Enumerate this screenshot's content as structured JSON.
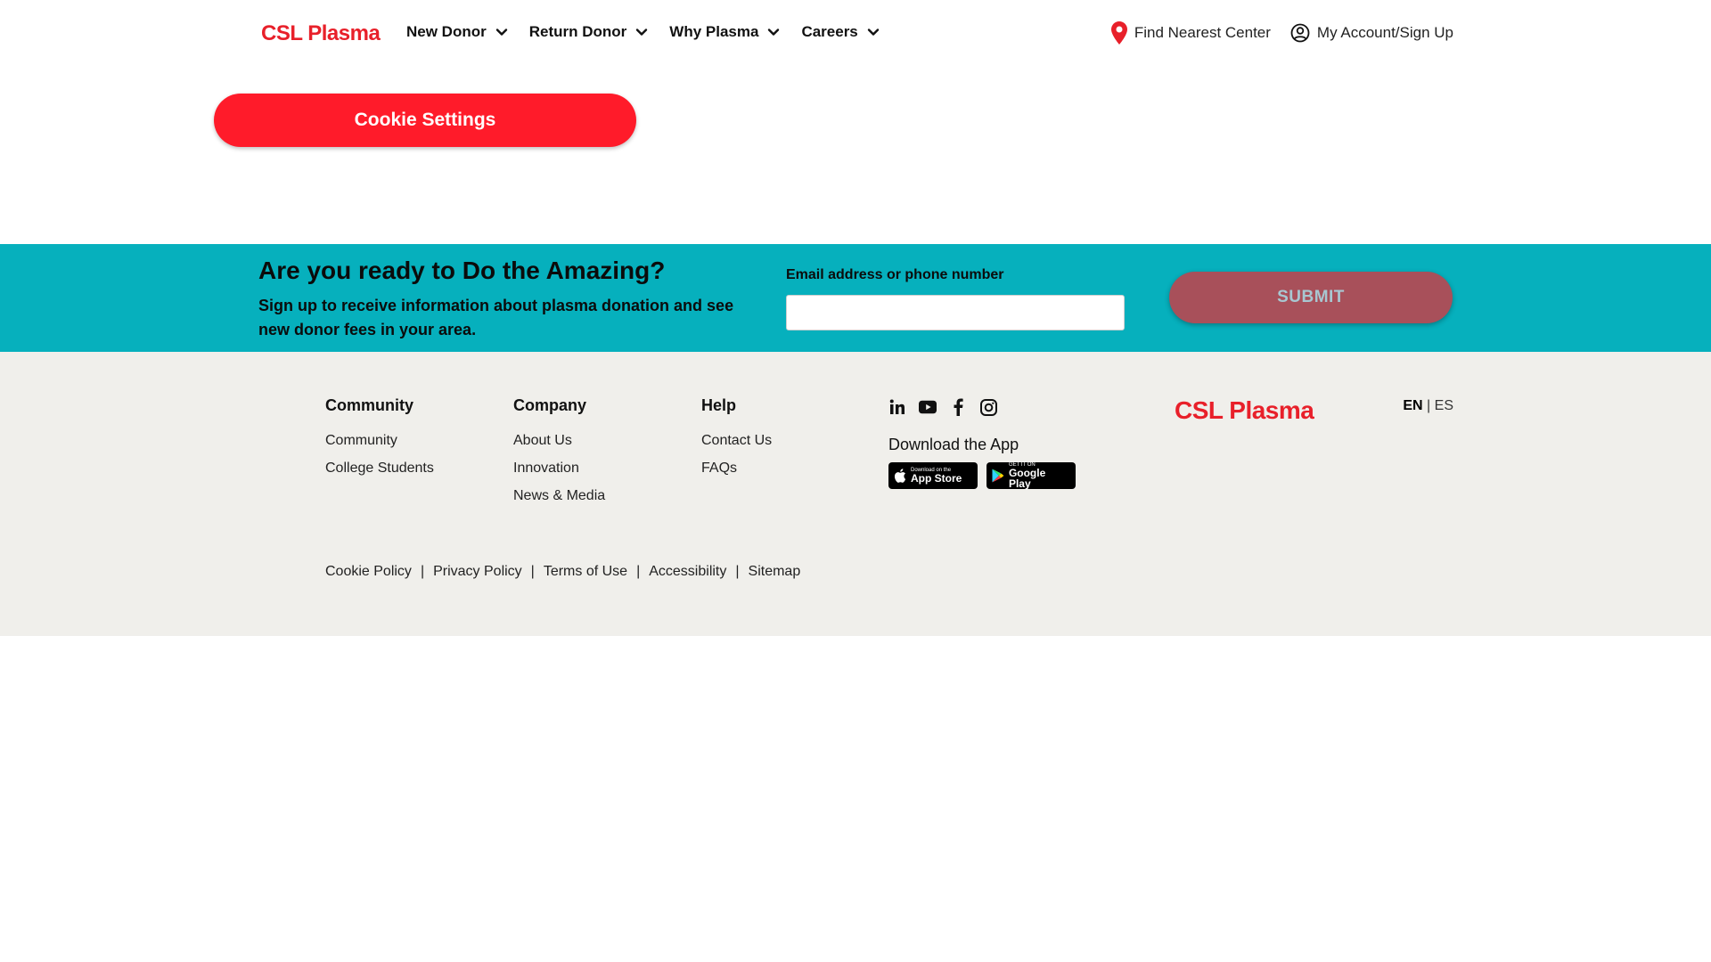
{
  "header": {
    "logo": "CSL Plasma",
    "nav": [
      {
        "label": "New Donor"
      },
      {
        "label": "Return Donor"
      },
      {
        "label": "Why Plasma"
      },
      {
        "label": "Careers"
      }
    ],
    "find_center": "Find Nearest Center",
    "account": "My Account/Sign Up"
  },
  "cookie_button": "Cookie Settings",
  "signup": {
    "title": "Are you ready to Do the Amazing?",
    "subtitle": "Sign up to receive information about plasma donation and see new donor fees in your area.",
    "email_label": "Email address or phone number",
    "email_value": "",
    "submit": "SUBMIT"
  },
  "footer": {
    "columns": [
      {
        "title": "Community",
        "links": [
          "Community",
          "College Students"
        ]
      },
      {
        "title": "Company",
        "links": [
          "About Us",
          "Innovation",
          "News & Media"
        ]
      },
      {
        "title": "Help",
        "links": [
          "Contact Us",
          "FAQs"
        ]
      }
    ],
    "social": [
      "linkedin-icon",
      "youtube-icon",
      "facebook-icon",
      "instagram-icon"
    ],
    "download_title": "Download the App",
    "app_store": {
      "small": "Download on the",
      "big": "App Store"
    },
    "google_play": {
      "small": "GET IT ON",
      "big": "Google Play"
    },
    "logo": "CSL Plasma",
    "lang_active": "EN",
    "lang_sep": "|",
    "lang_other": "ES",
    "legal": [
      "Cookie Policy",
      "Privacy Policy",
      "Terms of Use",
      "Accessibility",
      "Sitemap"
    ],
    "legal_sep": "|"
  },
  "colors": {
    "brand_red": "#e8202a",
    "cookie_button": "#ff1b2a",
    "signup_band": "#06b0bd",
    "submit_button": "#a8505a",
    "footer_bg": "#f0efeb"
  }
}
